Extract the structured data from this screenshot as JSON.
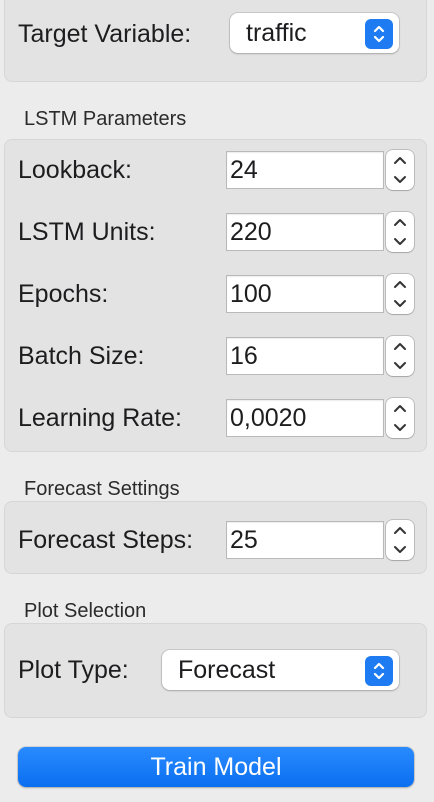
{
  "target": {
    "label": "Target Variable:",
    "selected": "traffic"
  },
  "lstm": {
    "title": "LSTM Parameters",
    "fields": [
      {
        "label": "Lookback:",
        "value": "24"
      },
      {
        "label": "LSTM Units:",
        "value": "220"
      },
      {
        "label": "Epochs:",
        "value": "100"
      },
      {
        "label": "Batch Size:",
        "value": "16"
      },
      {
        "label": "Learning Rate:",
        "value": "0,0020"
      }
    ]
  },
  "forecast": {
    "title": "Forecast Settings",
    "label": "Forecast Steps:",
    "value": "25"
  },
  "plot": {
    "title": "Plot Selection",
    "label": "Plot Type:",
    "selected": "Forecast"
  },
  "actions": {
    "train_label": "Train Model"
  },
  "colors": {
    "accent": "#1e7bf2",
    "background": "#ececec",
    "group": "#e3e3e3"
  }
}
